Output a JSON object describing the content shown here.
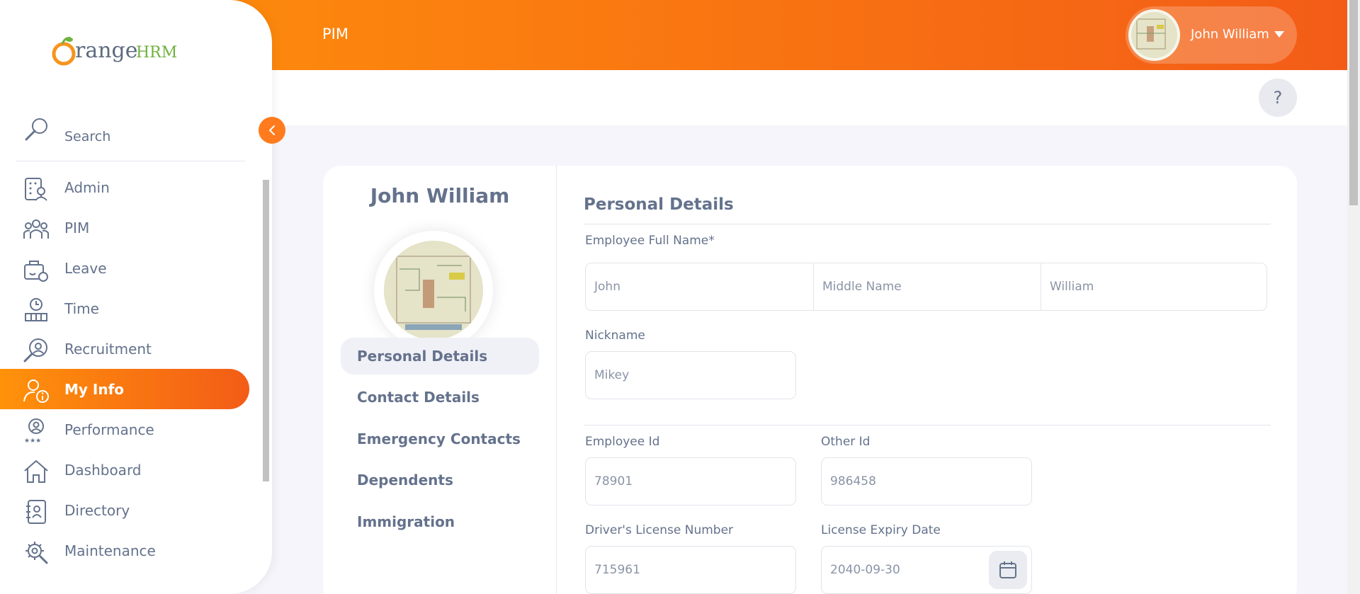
{
  "topbar": {
    "title": "PIM",
    "user_name": "John William"
  },
  "help": {
    "label": "?"
  },
  "sidebar": {
    "logo_text_main": "range",
    "logo_text_accent": "HRM",
    "search_label": "Search",
    "items": [
      {
        "label": "Admin",
        "icon": "admin-icon"
      },
      {
        "label": "PIM",
        "icon": "pim-icon"
      },
      {
        "label": "Leave",
        "icon": "leave-icon"
      },
      {
        "label": "Time",
        "icon": "time-icon"
      },
      {
        "label": "Recruitment",
        "icon": "recruitment-icon"
      },
      {
        "label": "My Info",
        "icon": "my-info-icon",
        "active": true
      },
      {
        "label": "Performance",
        "icon": "performance-icon"
      },
      {
        "label": "Dashboard",
        "icon": "dashboard-icon"
      },
      {
        "label": "Directory",
        "icon": "directory-icon"
      },
      {
        "label": "Maintenance",
        "icon": "maintenance-icon"
      }
    ]
  },
  "profile": {
    "name": "John William",
    "tabs": [
      "Personal Details",
      "Contact Details",
      "Emergency Contacts",
      "Dependents",
      "Immigration"
    ],
    "active_tab": "Personal Details"
  },
  "form": {
    "section_title": "Personal Details",
    "full_name_label": "Employee Full Name*",
    "first_name": "John",
    "middle_name_placeholder": "Middle Name",
    "last_name": "William",
    "nickname_label": "Nickname",
    "nickname": "Mikey",
    "employee_id_label": "Employee Id",
    "employee_id": "78901",
    "other_id_label": "Other Id",
    "other_id": "986458",
    "license_label": "Driver's License Number",
    "license": "715961",
    "license_expiry_label": "License Expiry Date",
    "license_expiry": "2040-09-30"
  },
  "colors": {
    "accent": "#ff7b1d",
    "accent_dark": "#f35c17",
    "text": "#64728c"
  }
}
